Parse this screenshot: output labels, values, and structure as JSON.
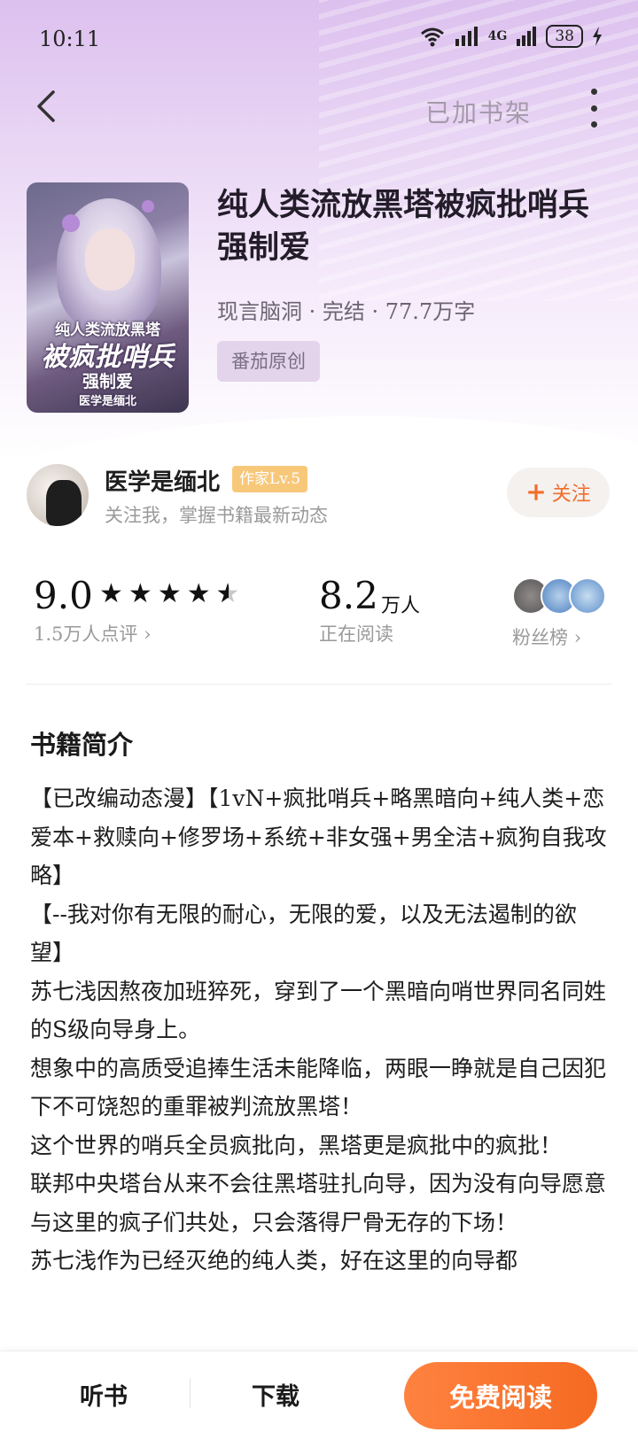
{
  "status_bar": {
    "time": "10:11",
    "signal_4g": "4G",
    "battery": "38"
  },
  "nav": {
    "shelf_label": "已加书架"
  },
  "book": {
    "title": "纯人类流放黑塔被疯批哨兵强制爱",
    "meta": "现言脑洞 · 完结 · 77.7万字",
    "tag": "番茄原创",
    "cover_text": {
      "line1": "纯人类流放黑塔",
      "line2": "被疯批哨兵",
      "line3": "强制爱",
      "line4": "医学是缅北"
    }
  },
  "author": {
    "name": "医学是缅北",
    "level": "作家Lv.5",
    "subtitle": "关注我，掌握书籍最新动态",
    "follow_label": "关注"
  },
  "stats": {
    "score": "9.0",
    "rating_count": "1.5万人点评",
    "rating_stars": 4.5,
    "readers": "8.2",
    "readers_unit": "万人",
    "readers_label": "正在阅读",
    "fans_label": "粉丝榜"
  },
  "intro": {
    "heading": "书籍简介",
    "paragraphs": [
      "【已改编动态漫】【1vN+疯批哨兵+略黑暗向+纯人类+恋爱本+救赎向+修罗场+系统+非女强+男全洁+疯狗自我攻略】",
      "【--我对你有无限的耐心，无限的爱，以及无法遏制的欲望】",
      "苏七浅因熬夜加班猝死，穿到了一个黑暗向哨世界同名同姓的S级向导身上。",
      "想象中的高质受追捧生活未能降临，两眼一睁就是自己因犯下不可饶恕的重罪被判流放黑塔！",
      "这个世界的哨兵全员疯批向，黑塔更是疯批中的疯批！",
      "联邦中央塔台从来不会往黑塔驻扎向导，因为没有向导愿意与这里的疯子们共处，只会落得尸骨无存的下场！",
      "苏七浅作为已经灭绝的纯人类，好在这里的向导都"
    ]
  },
  "bottom_bar": {
    "listen": "听书",
    "download": "下载",
    "read": "免费阅读"
  },
  "colors": {
    "accent": "#f56a22",
    "level_badge": "#f8c87a",
    "tag_bg": "#e3d4ec"
  }
}
